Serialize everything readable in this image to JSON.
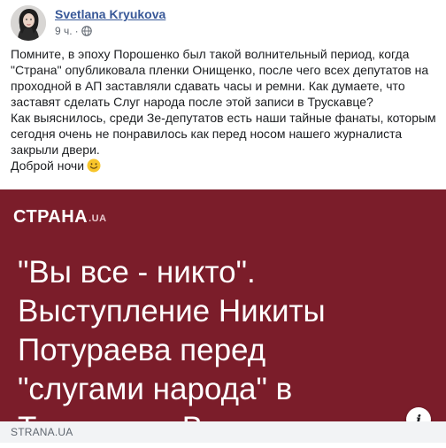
{
  "post": {
    "author": "Svetlana Kryukova",
    "time": "9 ч.",
    "separator": "·",
    "lines": [
      "Помните, в эпоху Порошенко был такой волнительный период, когда \"Страна\" опубликовала пленки Онищенко, после чего всех депутатов на проходной в АП заставляли сдавать часы и ремни. Как думаете, что заставят сделать Слуг народа после этой записи в Трускавце?",
      "Как выяснилось, среди Зе-депутатов есть наши тайные фанаты, которым сегодня очень не понравилось как перед носом нашего журналиста закрыли двери.",
      "Доброй ночи"
    ],
    "emoji": "slightly-smiling-face"
  },
  "link_card": {
    "brand": "СТРАНА",
    "brand_tld": ".UA",
    "headline_lines": [
      "\"Вы все - никто\".",
      "Выступление Никиты",
      "Потураева перед",
      "\"слугами народа\" в",
      "Трускавце. Видео"
    ],
    "info_icon": "i",
    "domain": "STRANA.UA",
    "background_color": "#7b1d2a"
  },
  "colors": {
    "author_link": "#385898",
    "meta_gray": "#606770",
    "footer_bg": "#f2f3f5"
  }
}
